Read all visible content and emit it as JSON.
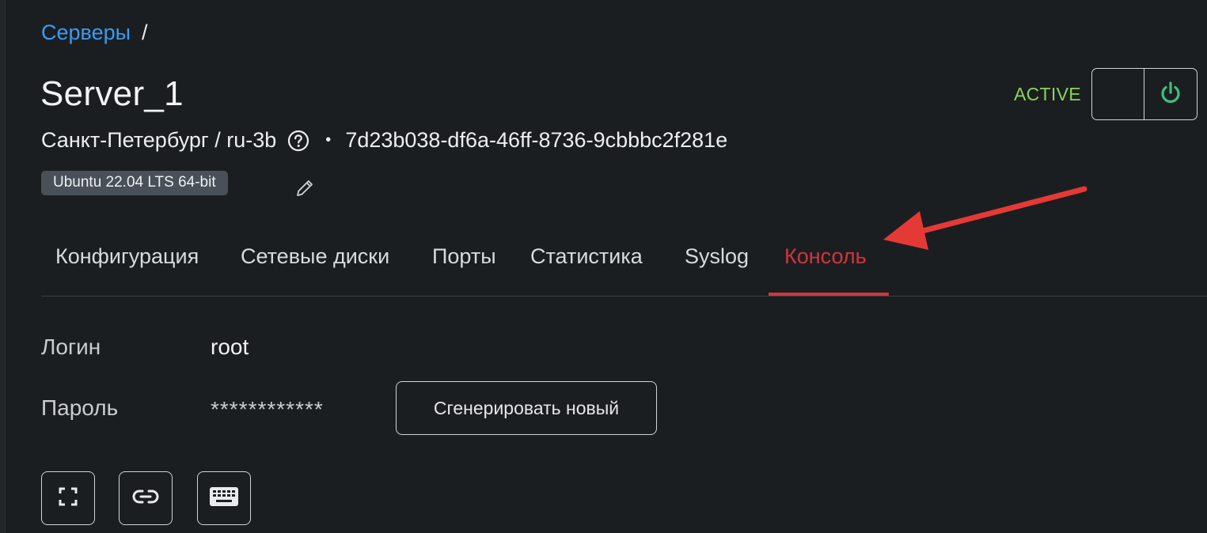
{
  "breadcrumb": {
    "link": "Серверы",
    "separator": "/"
  },
  "server": {
    "name": "Server_1",
    "location": "Санкт-Петербург / ru-3b",
    "dot": "•",
    "id": "7d23b038-df6a-46ff-8736-9cbbbc2f281e",
    "os": "Ubuntu 22.04 LTS 64-bit",
    "status": "ACTIVE"
  },
  "tabs": [
    {
      "label": "Конфигурация",
      "active": false
    },
    {
      "label": "Сетевые диски",
      "active": false
    },
    {
      "label": "Порты",
      "active": false
    },
    {
      "label": "Статистика",
      "active": false
    },
    {
      "label": "Syslog",
      "active": false
    },
    {
      "label": "Консоль",
      "active": true
    }
  ],
  "console": {
    "login_label": "Логин",
    "login_value": "root",
    "password_label": "Пароль",
    "password_value": "************",
    "generate_button": "Сгенерировать новый"
  },
  "icons": {
    "help": "help-circle-icon",
    "edit": "pencil-icon",
    "power": "power-icon",
    "fullscreen": "fullscreen-icon",
    "link": "link-icon",
    "keyboard": "keyboard-icon"
  },
  "colors": {
    "link": "#3b9bf0",
    "active_tab": "#d5343b",
    "status": "#8bd35a",
    "power": "#3fbf7f",
    "annotation_arrow": "#e53935"
  }
}
